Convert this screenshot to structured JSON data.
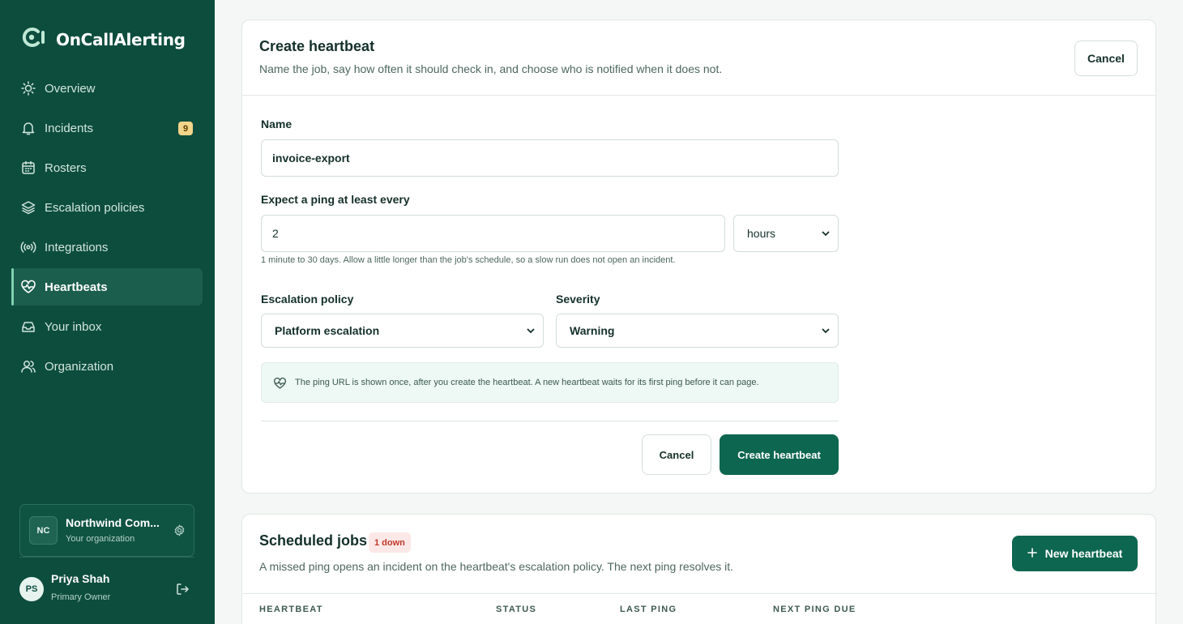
{
  "app": {
    "name": "OnCallAlerting"
  },
  "sidebar": {
    "items": [
      {
        "label": "Overview",
        "icon": "sun-icon"
      },
      {
        "label": "Incidents",
        "icon": "bell-icon",
        "badge": "9"
      },
      {
        "label": "Rosters",
        "icon": "calendar-icon"
      },
      {
        "label": "Escalation policies",
        "icon": "layers-icon"
      },
      {
        "label": "Integrations",
        "icon": "broadcast-icon"
      },
      {
        "label": "Heartbeats",
        "icon": "heart-pulse-icon",
        "active": true
      },
      {
        "label": "Your inbox",
        "icon": "inbox-icon"
      },
      {
        "label": "Organization",
        "icon": "users-icon"
      }
    ],
    "org": {
      "initials": "NC",
      "name": "Northwind Com...",
      "subtitle": "Your organization"
    },
    "user": {
      "initials": "PS",
      "name": "Priya Shah",
      "role": "Primary Owner"
    }
  },
  "create": {
    "title": "Create heartbeat",
    "description": "Name the job, say how often it should check in, and choose who is notified when it does not.",
    "cancel_label": "Cancel",
    "name_label": "Name",
    "name_value": "invoice-export",
    "interval_label": "Expect a ping at least every",
    "interval_value": "2",
    "interval_unit": "hours",
    "interval_hint": "1 minute to 30 days. Allow a little longer than the job's schedule, so a slow run does not open an incident.",
    "policy_label": "Escalation policy",
    "policy_value": "Platform escalation",
    "severity_label": "Severity",
    "severity_value": "Warning",
    "notice": "The ping URL is shown once, after you create the heartbeat. A new heartbeat waits for its first ping before it can page.",
    "footer_cancel_label": "Cancel",
    "submit_label": "Create heartbeat"
  },
  "jobs": {
    "title": "Scheduled jobs",
    "badge": "1 down",
    "description": "A missed ping opens an incident on the heartbeat's escalation policy. The next ping resolves it.",
    "new_label": "New heartbeat",
    "columns": [
      "HEARTBEAT",
      "STATUS",
      "LAST PING",
      "NEXT PING DUE"
    ]
  },
  "colors": {
    "sidebar": "#0d4d3e",
    "primary": "#0d6650",
    "accent": "#7fd0b0",
    "danger": "#c0392b"
  }
}
